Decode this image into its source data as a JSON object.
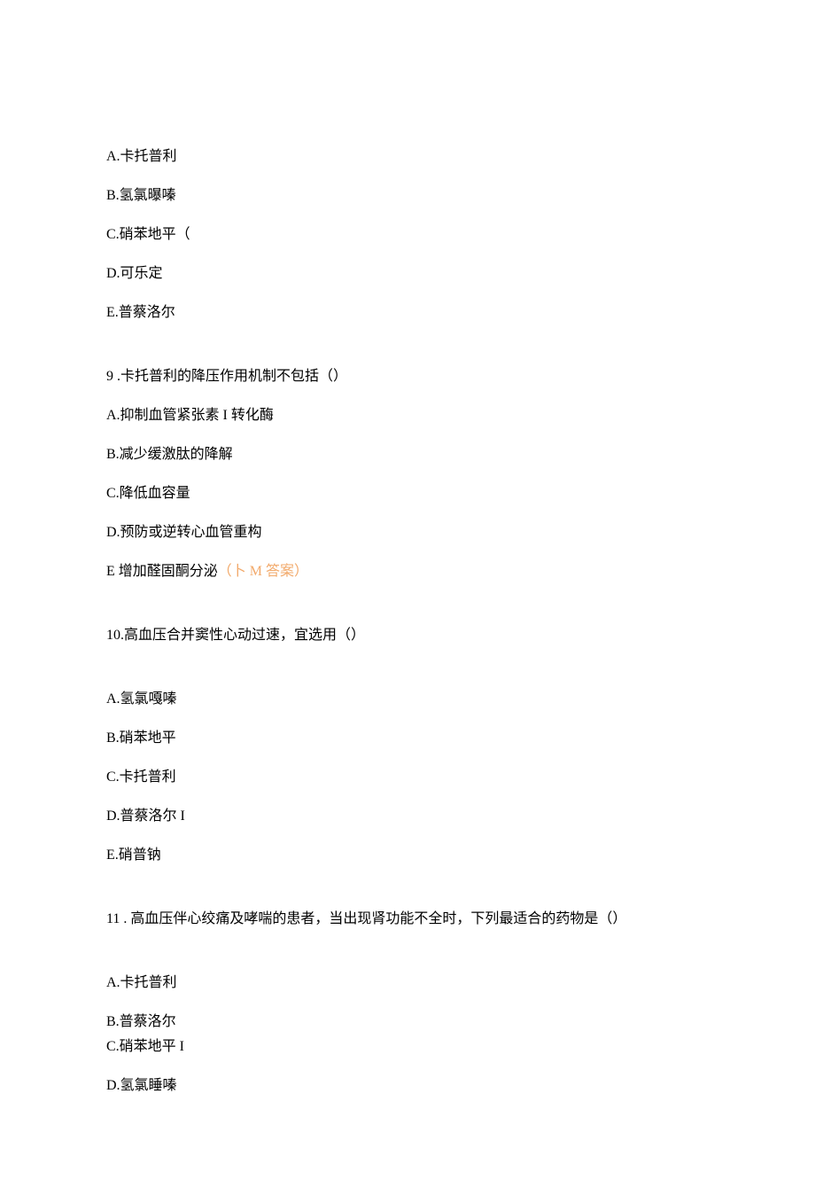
{
  "q8": {
    "options": {
      "A": "A.卡托普利",
      "B": "B.氢氯曝嗪",
      "C": "C.硝苯地平（",
      "D": "D.可乐定",
      "E": "E.普蔡洛尔"
    }
  },
  "q9": {
    "stem": "9 .卡托普利的降压作用机制不包括（）",
    "options": {
      "A": "A.抑制血管紧张素 I 转化酶",
      "B": "B.减少缓激肽的降解",
      "C": "C.降低血容量",
      "D": "D.预防或逆转心血管重构",
      "E_text": "E 增加醛固酮分泌",
      "E_answer": "（卜 M 答案）"
    }
  },
  "q10": {
    "stem": "10.高血压合并窦性心动过速，宜选用（）",
    "options": {
      "A": "A.氢氯嘎嗪",
      "B": "B.硝苯地平",
      "C": "C.卡托普利",
      "D": "D.普蔡洛尔 I",
      "E": "E.硝普钠"
    }
  },
  "q11": {
    "stem": "11 . 高血压伴心绞痛及哮喘的患者，当出现肾功能不全时，下列最适合的药物是（）",
    "options": {
      "A": "A.卡托普利",
      "B": "B.普蔡洛尔",
      "C": "C.硝苯地平 I",
      "D": "D.氢氯睡嗪"
    }
  }
}
